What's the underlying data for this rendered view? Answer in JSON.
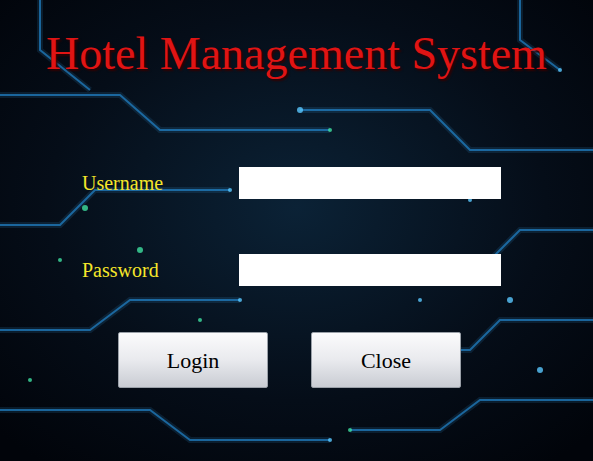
{
  "title": "Hotel Management System",
  "fields": [
    {
      "name": "username",
      "label": "Username",
      "value": "",
      "kind": "text"
    },
    {
      "name": "password",
      "label": "Password",
      "value": "",
      "kind": "password"
    }
  ],
  "buttons": [
    "Login",
    "Close"
  ]
}
